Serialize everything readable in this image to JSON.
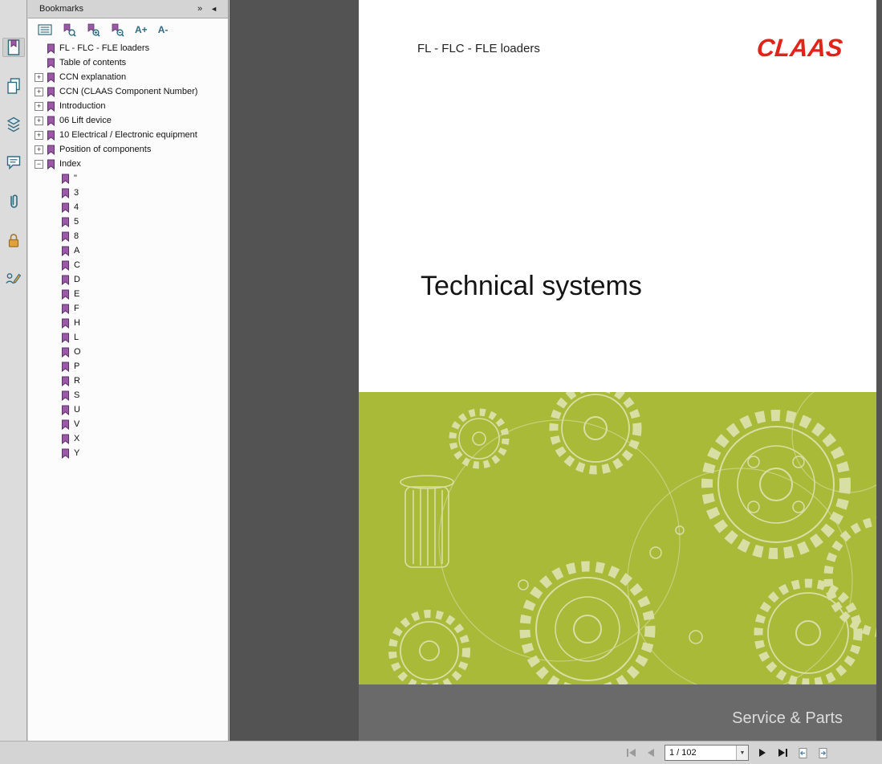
{
  "colors": {
    "claas_red": "#e2231a",
    "banner_green": "#a9b938",
    "footer_gray": "#6a6a6a",
    "viewer_gray": "#535353",
    "chrome_gray": "#d4d4d4",
    "icon_teal": "#2f6b80",
    "bookmark_purple": "#9b59a8"
  },
  "left_panel": {
    "icons": [
      {
        "name": "bookmark-panel-icon",
        "selected": true
      },
      {
        "name": "pages-panel-icon",
        "selected": false
      },
      {
        "name": "layers-panel-icon",
        "selected": false
      },
      {
        "name": "comments-panel-icon",
        "selected": false
      },
      {
        "name": "attachments-panel-icon",
        "selected": false
      },
      {
        "name": "security-panel-icon",
        "selected": false
      },
      {
        "name": "signature-panel-icon",
        "selected": false
      }
    ]
  },
  "bookmarks": {
    "title": "Bookmarks",
    "collapse_icon": "»",
    "hide_icon": "◄",
    "toolbar": {
      "increase_text": "A+",
      "decrease_text": "A-"
    },
    "items": [
      {
        "label": "FL - FLC - FLE loaders",
        "level": 0,
        "expander": null
      },
      {
        "label": "Table of contents",
        "level": 0,
        "expander": null
      },
      {
        "label": "CCN explanation",
        "level": 0,
        "expander": "+"
      },
      {
        "label": "CCN (CLAAS Component Number)",
        "level": 0,
        "expander": "+"
      },
      {
        "label": "Introduction",
        "level": 0,
        "expander": "+"
      },
      {
        "label": "06 Lift device",
        "level": 0,
        "expander": "+"
      },
      {
        "label": "10 Electrical / Electronic equipment",
        "level": 0,
        "expander": "+"
      },
      {
        "label": "Position of components",
        "level": 0,
        "expander": "+"
      },
      {
        "label": "Index",
        "level": 0,
        "expander": "-"
      },
      {
        "label": "\"",
        "level": 1,
        "expander": null
      },
      {
        "label": "3",
        "level": 1,
        "expander": null
      },
      {
        "label": "4",
        "level": 1,
        "expander": null
      },
      {
        "label": "5",
        "level": 1,
        "expander": null
      },
      {
        "label": "8",
        "level": 1,
        "expander": null
      },
      {
        "label": "A",
        "level": 1,
        "expander": null
      },
      {
        "label": "C",
        "level": 1,
        "expander": null
      },
      {
        "label": "D",
        "level": 1,
        "expander": null
      },
      {
        "label": "E",
        "level": 1,
        "expander": null
      },
      {
        "label": "F",
        "level": 1,
        "expander": null
      },
      {
        "label": "H",
        "level": 1,
        "expander": null
      },
      {
        "label": "L",
        "level": 1,
        "expander": null
      },
      {
        "label": "O",
        "level": 1,
        "expander": null
      },
      {
        "label": "P",
        "level": 1,
        "expander": null
      },
      {
        "label": "R",
        "level": 1,
        "expander": null
      },
      {
        "label": "S",
        "level": 1,
        "expander": null
      },
      {
        "label": "U",
        "level": 1,
        "expander": null
      },
      {
        "label": "V",
        "level": 1,
        "expander": null
      },
      {
        "label": "X",
        "level": 1,
        "expander": null
      },
      {
        "label": "Y",
        "level": 1,
        "expander": null
      }
    ]
  },
  "document": {
    "header": "FL - FLC - FLE loaders",
    "logo_text": "CLAAS",
    "title": "Technical systems",
    "footer": "Service & Parts"
  },
  "navigation": {
    "page_field": "1 / 102"
  }
}
